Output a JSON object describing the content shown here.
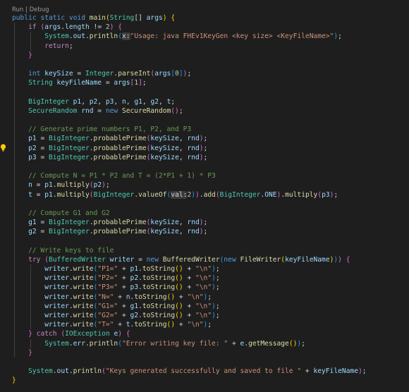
{
  "codelens": {
    "run": "Run",
    "separator": " | ",
    "debug": "Debug"
  },
  "colors": {
    "background": "#1e1e1e",
    "keyword": "#569cd6",
    "control": "#c586c0",
    "type": "#4ec9b0",
    "function": "#dcdcaa",
    "variable": "#9cdcfe",
    "string": "#ce9178",
    "number": "#b5cea8",
    "comment": "#6a9955",
    "bracket_1": "#ffd700",
    "bracket_2": "#da70d6",
    "bracket_3": "#179fff"
  },
  "icons": {
    "gutter": "lightbulb-icon"
  },
  "lines": [
    [
      [
        "kw",
        "public"
      ],
      [
        "pu",
        " "
      ],
      [
        "kw",
        "static"
      ],
      [
        "pu",
        " "
      ],
      [
        "kw",
        "void"
      ],
      [
        "pu",
        " "
      ],
      [
        "fn",
        "main"
      ],
      [
        "br1",
        "("
      ],
      [
        "type",
        "String"
      ],
      [
        "pu",
        "[] "
      ],
      [
        "var",
        "args"
      ],
      [
        "br1",
        ")"
      ],
      [
        "pu",
        " "
      ],
      [
        "br1",
        "{"
      ]
    ],
    [
      [
        "pu",
        "    "
      ],
      [
        "kw2",
        "if"
      ],
      [
        "pu",
        " "
      ],
      [
        "br2",
        "("
      ],
      [
        "var",
        "args"
      ],
      [
        "pu",
        "."
      ],
      [
        "var",
        "length"
      ],
      [
        "pu",
        " != "
      ],
      [
        "num",
        "2"
      ],
      [
        "br2",
        ")"
      ],
      [
        "pu",
        " "
      ],
      [
        "br2",
        "{"
      ]
    ],
    [
      [
        "pu",
        "        "
      ],
      [
        "type",
        "System"
      ],
      [
        "pu",
        "."
      ],
      [
        "var",
        "out"
      ],
      [
        "pu",
        "."
      ],
      [
        "fn",
        "println"
      ],
      [
        "br3",
        "("
      ],
      [
        "hint",
        "x:"
      ],
      [
        "str",
        "\"Usage: java FHEv1KeyGen <key size> <KeyFileName>\""
      ],
      [
        "br3",
        ")"
      ],
      [
        "pu",
        ";"
      ]
    ],
    [
      [
        "pu",
        "        "
      ],
      [
        "kw2",
        "return"
      ],
      [
        "pu",
        ";"
      ]
    ],
    [
      [
        "pu",
        "    "
      ],
      [
        "br2",
        "}"
      ]
    ],
    [],
    [
      [
        "pu",
        "    "
      ],
      [
        "kw",
        "int"
      ],
      [
        "pu",
        " "
      ],
      [
        "var",
        "keySize"
      ],
      [
        "pu",
        " = "
      ],
      [
        "type",
        "Integer"
      ],
      [
        "pu",
        "."
      ],
      [
        "fn",
        "parseInt"
      ],
      [
        "br2",
        "("
      ],
      [
        "var",
        "args"
      ],
      [
        "br3",
        "["
      ],
      [
        "num",
        "0"
      ],
      [
        "br3",
        "]"
      ],
      [
        "br2",
        ")"
      ],
      [
        "pu",
        ";"
      ]
    ],
    [
      [
        "pu",
        "    "
      ],
      [
        "type",
        "String"
      ],
      [
        "pu",
        " "
      ],
      [
        "var",
        "keyFileName"
      ],
      [
        "pu",
        " = "
      ],
      [
        "var",
        "args"
      ],
      [
        "br2",
        "["
      ],
      [
        "num",
        "1"
      ],
      [
        "br2",
        "]"
      ],
      [
        "pu",
        ";"
      ]
    ],
    [],
    [
      [
        "pu",
        "    "
      ],
      [
        "type",
        "BigInteger"
      ],
      [
        "pu",
        " "
      ],
      [
        "var",
        "p1"
      ],
      [
        "pu",
        ", "
      ],
      [
        "var",
        "p2"
      ],
      [
        "pu",
        ", "
      ],
      [
        "var",
        "p3"
      ],
      [
        "pu",
        ", "
      ],
      [
        "var",
        "n"
      ],
      [
        "pu",
        ", "
      ],
      [
        "var",
        "g1"
      ],
      [
        "pu",
        ", "
      ],
      [
        "var",
        "g2"
      ],
      [
        "pu",
        ", "
      ],
      [
        "var",
        "t"
      ],
      [
        "pu",
        ";"
      ]
    ],
    [
      [
        "pu",
        "    "
      ],
      [
        "type",
        "SecureRandom"
      ],
      [
        "pu",
        " "
      ],
      [
        "var",
        "rnd"
      ],
      [
        "pu",
        " = "
      ],
      [
        "kw",
        "new"
      ],
      [
        "pu",
        " "
      ],
      [
        "fn",
        "SecureRandom"
      ],
      [
        "br2",
        "()"
      ],
      [
        "pu",
        ";"
      ]
    ],
    [],
    [
      [
        "pu",
        "    "
      ],
      [
        "cm",
        "// Generate prime numbers P1, P2, and P3"
      ]
    ],
    [
      [
        "pu",
        "    "
      ],
      [
        "var",
        "p1"
      ],
      [
        "pu",
        " = "
      ],
      [
        "type",
        "BigInteger"
      ],
      [
        "pu",
        "."
      ],
      [
        "fn",
        "probablePrime"
      ],
      [
        "br2",
        "("
      ],
      [
        "var",
        "keySize"
      ],
      [
        "pu",
        ", "
      ],
      [
        "var",
        "rnd"
      ],
      [
        "br2",
        ")"
      ],
      [
        "pu",
        ";"
      ]
    ],
    [
      [
        "pu",
        "    "
      ],
      [
        "var",
        "p2"
      ],
      [
        "pu",
        " = "
      ],
      [
        "type",
        "BigInteger"
      ],
      [
        "pu",
        "."
      ],
      [
        "fn",
        "probablePrime"
      ],
      [
        "br2",
        "("
      ],
      [
        "var",
        "keySize"
      ],
      [
        "pu",
        ", "
      ],
      [
        "var",
        "rnd"
      ],
      [
        "br2",
        ")"
      ],
      [
        "pu",
        ";"
      ]
    ],
    [
      [
        "pu",
        "    "
      ],
      [
        "var",
        "p3"
      ],
      [
        "pu",
        " = "
      ],
      [
        "type",
        "BigInteger"
      ],
      [
        "pu",
        "."
      ],
      [
        "fn",
        "probablePrime"
      ],
      [
        "br2",
        "("
      ],
      [
        "var",
        "keySize"
      ],
      [
        "pu",
        ", "
      ],
      [
        "var",
        "rnd"
      ],
      [
        "br2",
        ")"
      ],
      [
        "pu",
        ";"
      ]
    ],
    [],
    [
      [
        "pu",
        "    "
      ],
      [
        "cm",
        "// Compute N = P1 * P2 and T = (2*P1 + 1) * P3"
      ]
    ],
    [
      [
        "pu",
        "    "
      ],
      [
        "var",
        "n"
      ],
      [
        "pu",
        " = "
      ],
      [
        "var",
        "p1"
      ],
      [
        "pu",
        "."
      ],
      [
        "fn",
        "multiply"
      ],
      [
        "br2",
        "("
      ],
      [
        "var",
        "p2"
      ],
      [
        "br2",
        ")"
      ],
      [
        "pu",
        ";"
      ]
    ],
    [
      [
        "pu",
        "    "
      ],
      [
        "var",
        "t"
      ],
      [
        "pu",
        " = "
      ],
      [
        "var",
        "p1"
      ],
      [
        "pu",
        "."
      ],
      [
        "fn",
        "multiply"
      ],
      [
        "br2",
        "("
      ],
      [
        "type",
        "BigInteger"
      ],
      [
        "pu",
        "."
      ],
      [
        "fn",
        "valueOf"
      ],
      [
        "br3",
        "("
      ],
      [
        "hint",
        "val:"
      ],
      [
        "num",
        "2"
      ],
      [
        "br3",
        ")"
      ],
      [
        "br2",
        ")"
      ],
      [
        "pu",
        "."
      ],
      [
        "fn",
        "add"
      ],
      [
        "br2",
        "("
      ],
      [
        "type",
        "BigInteger"
      ],
      [
        "pu",
        "."
      ],
      [
        "var",
        "ONE"
      ],
      [
        "br2",
        ")"
      ],
      [
        "pu",
        "."
      ],
      [
        "fn",
        "multiply"
      ],
      [
        "br2",
        "("
      ],
      [
        "var",
        "p3"
      ],
      [
        "br2",
        ")"
      ],
      [
        "pu",
        ";"
      ]
    ],
    [],
    [
      [
        "pu",
        "    "
      ],
      [
        "cm",
        "// Compute G1 and G2"
      ]
    ],
    [
      [
        "pu",
        "    "
      ],
      [
        "var",
        "g1"
      ],
      [
        "pu",
        " = "
      ],
      [
        "type",
        "BigInteger"
      ],
      [
        "pu",
        "."
      ],
      [
        "fn",
        "probablePrime"
      ],
      [
        "br2",
        "("
      ],
      [
        "var",
        "keySize"
      ],
      [
        "pu",
        ", "
      ],
      [
        "var",
        "rnd"
      ],
      [
        "br2",
        ")"
      ],
      [
        "pu",
        ";"
      ]
    ],
    [
      [
        "pu",
        "    "
      ],
      [
        "var",
        "g2"
      ],
      [
        "pu",
        " = "
      ],
      [
        "type",
        "BigInteger"
      ],
      [
        "pu",
        "."
      ],
      [
        "fn",
        "probablePrime"
      ],
      [
        "br2",
        "("
      ],
      [
        "var",
        "keySize"
      ],
      [
        "pu",
        ", "
      ],
      [
        "var",
        "rnd"
      ],
      [
        "br2",
        ")"
      ],
      [
        "pu",
        ";"
      ]
    ],
    [],
    [
      [
        "pu",
        "    "
      ],
      [
        "cm",
        "// Write keys to file"
      ]
    ],
    [
      [
        "pu",
        "    "
      ],
      [
        "kw2",
        "try"
      ],
      [
        "pu",
        " "
      ],
      [
        "br2",
        "("
      ],
      [
        "type",
        "BufferedWriter"
      ],
      [
        "pu",
        " "
      ],
      [
        "var",
        "writer"
      ],
      [
        "pu",
        " = "
      ],
      [
        "kw",
        "new"
      ],
      [
        "pu",
        " "
      ],
      [
        "fn",
        "BufferedWriter"
      ],
      [
        "br3",
        "("
      ],
      [
        "kw",
        "new"
      ],
      [
        "pu",
        " "
      ],
      [
        "fn",
        "FileWriter"
      ],
      [
        "br1",
        "("
      ],
      [
        "var",
        "keyFileName"
      ],
      [
        "br1",
        ")"
      ],
      [
        "br3",
        ")"
      ],
      [
        "br2",
        ")"
      ],
      [
        "pu",
        " "
      ],
      [
        "br2",
        "{"
      ]
    ],
    [
      [
        "pu",
        "        "
      ],
      [
        "var",
        "writer"
      ],
      [
        "pu",
        "."
      ],
      [
        "fn",
        "write"
      ],
      [
        "br3",
        "("
      ],
      [
        "str",
        "\"P1=\""
      ],
      [
        "pu",
        " + "
      ],
      [
        "var",
        "p1"
      ],
      [
        "pu",
        "."
      ],
      [
        "fn",
        "toString"
      ],
      [
        "br1",
        "()"
      ],
      [
        "pu",
        " + "
      ],
      [
        "str",
        "\"\\n\""
      ],
      [
        "br3",
        ")"
      ],
      [
        "pu",
        ";"
      ]
    ],
    [
      [
        "pu",
        "        "
      ],
      [
        "var",
        "writer"
      ],
      [
        "pu",
        "."
      ],
      [
        "fn",
        "write"
      ],
      [
        "br3",
        "("
      ],
      [
        "str",
        "\"P2=\""
      ],
      [
        "pu",
        " + "
      ],
      [
        "var",
        "p2"
      ],
      [
        "pu",
        "."
      ],
      [
        "fn",
        "toString"
      ],
      [
        "br1",
        "()"
      ],
      [
        "pu",
        " + "
      ],
      [
        "str",
        "\"\\n\""
      ],
      [
        "br3",
        ")"
      ],
      [
        "pu",
        ";"
      ]
    ],
    [
      [
        "pu",
        "        "
      ],
      [
        "var",
        "writer"
      ],
      [
        "pu",
        "."
      ],
      [
        "fn",
        "write"
      ],
      [
        "br3",
        "("
      ],
      [
        "str",
        "\"P3=\""
      ],
      [
        "pu",
        " + "
      ],
      [
        "var",
        "p3"
      ],
      [
        "pu",
        "."
      ],
      [
        "fn",
        "toString"
      ],
      [
        "br1",
        "()"
      ],
      [
        "pu",
        " + "
      ],
      [
        "str",
        "\"\\n\""
      ],
      [
        "br3",
        ")"
      ],
      [
        "pu",
        ";"
      ]
    ],
    [
      [
        "pu",
        "        "
      ],
      [
        "var",
        "writer"
      ],
      [
        "pu",
        "."
      ],
      [
        "fn",
        "write"
      ],
      [
        "br3",
        "("
      ],
      [
        "str",
        "\"N=\""
      ],
      [
        "pu",
        " + "
      ],
      [
        "var",
        "n"
      ],
      [
        "pu",
        "."
      ],
      [
        "fn",
        "toString"
      ],
      [
        "br1",
        "()"
      ],
      [
        "pu",
        " + "
      ],
      [
        "str",
        "\"\\n\""
      ],
      [
        "br3",
        ")"
      ],
      [
        "pu",
        ";"
      ]
    ],
    [
      [
        "pu",
        "        "
      ],
      [
        "var",
        "writer"
      ],
      [
        "pu",
        "."
      ],
      [
        "fn",
        "write"
      ],
      [
        "br3",
        "("
      ],
      [
        "str",
        "\"G1=\""
      ],
      [
        "pu",
        " + "
      ],
      [
        "var",
        "g1"
      ],
      [
        "pu",
        "."
      ],
      [
        "fn",
        "toString"
      ],
      [
        "br1",
        "()"
      ],
      [
        "pu",
        " + "
      ],
      [
        "str",
        "\"\\n\""
      ],
      [
        "br3",
        ")"
      ],
      [
        "pu",
        ";"
      ]
    ],
    [
      [
        "pu",
        "        "
      ],
      [
        "var",
        "writer"
      ],
      [
        "pu",
        "."
      ],
      [
        "fn",
        "write"
      ],
      [
        "br3",
        "("
      ],
      [
        "str",
        "\"G2=\""
      ],
      [
        "pu",
        " + "
      ],
      [
        "var",
        "g2"
      ],
      [
        "pu",
        "."
      ],
      [
        "fn",
        "toString"
      ],
      [
        "br1",
        "()"
      ],
      [
        "pu",
        " + "
      ],
      [
        "str",
        "\"\\n\""
      ],
      [
        "br3",
        ")"
      ],
      [
        "pu",
        ";"
      ]
    ],
    [
      [
        "pu",
        "        "
      ],
      [
        "var",
        "writer"
      ],
      [
        "pu",
        "."
      ],
      [
        "fn",
        "write"
      ],
      [
        "br3",
        "("
      ],
      [
        "str",
        "\"T=\""
      ],
      [
        "pu",
        " + "
      ],
      [
        "var",
        "t"
      ],
      [
        "pu",
        "."
      ],
      [
        "fn",
        "toString"
      ],
      [
        "br1",
        "()"
      ],
      [
        "pu",
        " + "
      ],
      [
        "str",
        "\"\\n\""
      ],
      [
        "br3",
        ")"
      ],
      [
        "pu",
        ";"
      ]
    ],
    [
      [
        "pu",
        "    "
      ],
      [
        "br2",
        "}"
      ],
      [
        "pu",
        " "
      ],
      [
        "kw2",
        "catch"
      ],
      [
        "pu",
        " "
      ],
      [
        "br2",
        "("
      ],
      [
        "type",
        "IOException"
      ],
      [
        "pu",
        " "
      ],
      [
        "var",
        "e"
      ],
      [
        "br2",
        ")"
      ],
      [
        "pu",
        " "
      ],
      [
        "br2",
        "{"
      ]
    ],
    [
      [
        "pu",
        "        "
      ],
      [
        "type",
        "System"
      ],
      [
        "pu",
        "."
      ],
      [
        "var",
        "err"
      ],
      [
        "pu",
        "."
      ],
      [
        "fn",
        "println"
      ],
      [
        "br3",
        "("
      ],
      [
        "str",
        "\"Error writing key file: \""
      ],
      [
        "pu",
        " + "
      ],
      [
        "var",
        "e"
      ],
      [
        "pu",
        "."
      ],
      [
        "fn",
        "getMessage"
      ],
      [
        "br1",
        "()"
      ],
      [
        "br3",
        ")"
      ],
      [
        "pu",
        ";"
      ]
    ],
    [
      [
        "pu",
        "    "
      ],
      [
        "br2",
        "}"
      ]
    ],
    [],
    [
      [
        "pu",
        "    "
      ],
      [
        "type",
        "System"
      ],
      [
        "pu",
        "."
      ],
      [
        "var",
        "out"
      ],
      [
        "pu",
        "."
      ],
      [
        "fn",
        "println"
      ],
      [
        "br2",
        "("
      ],
      [
        "str",
        "\"Keys generated successfully and saved to file \""
      ],
      [
        "pu",
        " + "
      ],
      [
        "var",
        "keyFileName"
      ],
      [
        "br2",
        ")"
      ],
      [
        "pu",
        ";"
      ]
    ],
    [
      [
        "br1",
        "}"
      ]
    ]
  ]
}
